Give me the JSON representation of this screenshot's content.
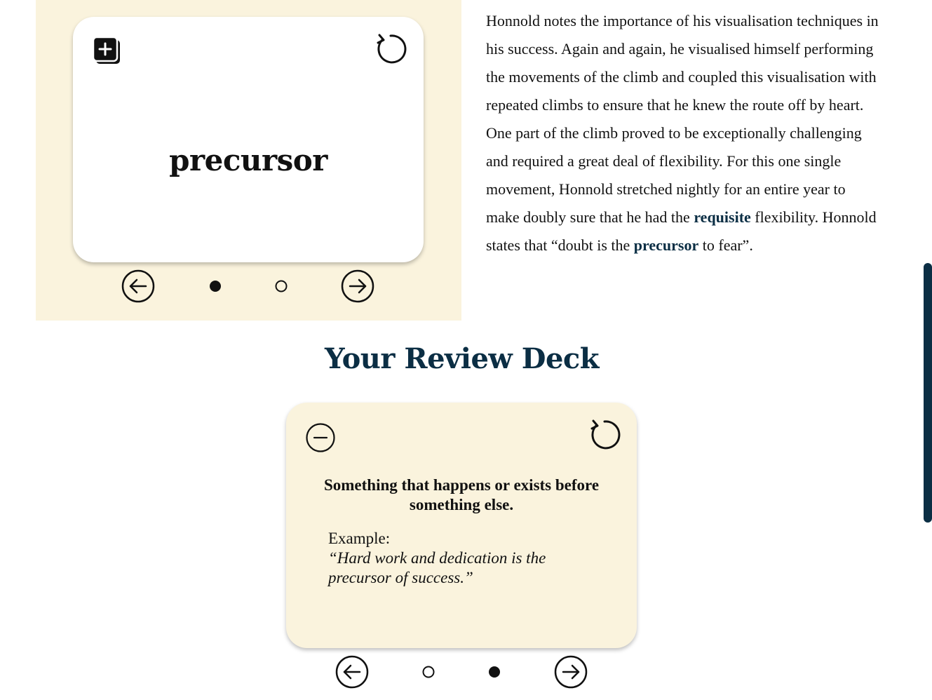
{
  "flashcard": {
    "word": "precursor"
  },
  "passage": {
    "segments": [
      {
        "text": "Honnold notes the importance of his visualisation techniques in his success. Again and again, he visualised himself performing the movements of the climb and coupled this visualisation with repeated climbs to ensure that he knew the route off by heart. One part of the climb proved to be exceptionally challenging and required a great deal of flexibility. For this one single movement, Honnold stretched nightly for an entire year to make doubly sure that he had the ",
        "bold": false
      },
      {
        "text": "requisite",
        "bold": true
      },
      {
        "text": " flexibility. Honnold states that “doubt is the ",
        "bold": false
      },
      {
        "text": "precursor",
        "bold": true
      },
      {
        "text": " to fear”.",
        "bold": false
      }
    ]
  },
  "review": {
    "title": "Your Review Deck",
    "definition": "Something that happens or exists before something else.",
    "example_label": "Example:",
    "example_text": "“Hard work and dedication is the precursor of success.”"
  },
  "top_pager": {
    "active_index": 0,
    "count": 2
  },
  "review_pager": {
    "active_index": 1,
    "count": 2
  },
  "colors": {
    "panel_bg": "#faf3dd",
    "accent": "#0b2e44",
    "text": "#111111"
  },
  "icons": {
    "add": "add-to-deck-icon",
    "flip": "flip-card-icon",
    "remove": "remove-from-deck-icon",
    "prev": "arrow-left-icon",
    "next": "arrow-right-icon"
  }
}
